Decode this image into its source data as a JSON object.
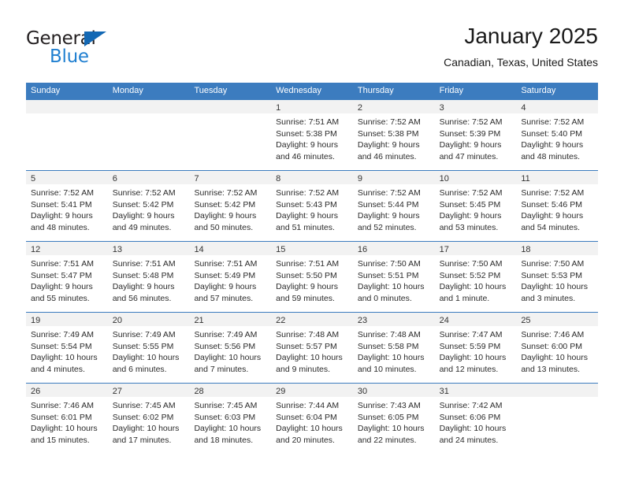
{
  "logo": {
    "word_top": "General",
    "word_bottom": "Blue",
    "triangle_icon": "triangle-icon",
    "color_blue": "#1f7fd0",
    "color_triangle": "#1368b4",
    "color_dark": "#231f20"
  },
  "header": {
    "title": "January 2025",
    "subtitle": "Canadian, Texas, United States"
  },
  "theme": {
    "header_bg": "#3c7cbf",
    "header_text": "#ffffff",
    "day_band_bg": "#f2f2f2",
    "row_border": "#3c7cbf"
  },
  "weekdays": [
    "Sunday",
    "Monday",
    "Tuesday",
    "Wednesday",
    "Thursday",
    "Friday",
    "Saturday"
  ],
  "weeks": [
    [
      {
        "day": "",
        "sunrise": "",
        "sunset": "",
        "daylight_line1": "",
        "daylight_line2": ""
      },
      {
        "day": "",
        "sunrise": "",
        "sunset": "",
        "daylight_line1": "",
        "daylight_line2": ""
      },
      {
        "day": "",
        "sunrise": "",
        "sunset": "",
        "daylight_line1": "",
        "daylight_line2": ""
      },
      {
        "day": "1",
        "sunrise": "Sunrise: 7:51 AM",
        "sunset": "Sunset: 5:38 PM",
        "daylight_line1": "Daylight: 9 hours",
        "daylight_line2": "and 46 minutes."
      },
      {
        "day": "2",
        "sunrise": "Sunrise: 7:52 AM",
        "sunset": "Sunset: 5:38 PM",
        "daylight_line1": "Daylight: 9 hours",
        "daylight_line2": "and 46 minutes."
      },
      {
        "day": "3",
        "sunrise": "Sunrise: 7:52 AM",
        "sunset": "Sunset: 5:39 PM",
        "daylight_line1": "Daylight: 9 hours",
        "daylight_line2": "and 47 minutes."
      },
      {
        "day": "4",
        "sunrise": "Sunrise: 7:52 AM",
        "sunset": "Sunset: 5:40 PM",
        "daylight_line1": "Daylight: 9 hours",
        "daylight_line2": "and 48 minutes."
      }
    ],
    [
      {
        "day": "5",
        "sunrise": "Sunrise: 7:52 AM",
        "sunset": "Sunset: 5:41 PM",
        "daylight_line1": "Daylight: 9 hours",
        "daylight_line2": "and 48 minutes."
      },
      {
        "day": "6",
        "sunrise": "Sunrise: 7:52 AM",
        "sunset": "Sunset: 5:42 PM",
        "daylight_line1": "Daylight: 9 hours",
        "daylight_line2": "and 49 minutes."
      },
      {
        "day": "7",
        "sunrise": "Sunrise: 7:52 AM",
        "sunset": "Sunset: 5:42 PM",
        "daylight_line1": "Daylight: 9 hours",
        "daylight_line2": "and 50 minutes."
      },
      {
        "day": "8",
        "sunrise": "Sunrise: 7:52 AM",
        "sunset": "Sunset: 5:43 PM",
        "daylight_line1": "Daylight: 9 hours",
        "daylight_line2": "and 51 minutes."
      },
      {
        "day": "9",
        "sunrise": "Sunrise: 7:52 AM",
        "sunset": "Sunset: 5:44 PM",
        "daylight_line1": "Daylight: 9 hours",
        "daylight_line2": "and 52 minutes."
      },
      {
        "day": "10",
        "sunrise": "Sunrise: 7:52 AM",
        "sunset": "Sunset: 5:45 PM",
        "daylight_line1": "Daylight: 9 hours",
        "daylight_line2": "and 53 minutes."
      },
      {
        "day": "11",
        "sunrise": "Sunrise: 7:52 AM",
        "sunset": "Sunset: 5:46 PM",
        "daylight_line1": "Daylight: 9 hours",
        "daylight_line2": "and 54 minutes."
      }
    ],
    [
      {
        "day": "12",
        "sunrise": "Sunrise: 7:51 AM",
        "sunset": "Sunset: 5:47 PM",
        "daylight_line1": "Daylight: 9 hours",
        "daylight_line2": "and 55 minutes."
      },
      {
        "day": "13",
        "sunrise": "Sunrise: 7:51 AM",
        "sunset": "Sunset: 5:48 PM",
        "daylight_line1": "Daylight: 9 hours",
        "daylight_line2": "and 56 minutes."
      },
      {
        "day": "14",
        "sunrise": "Sunrise: 7:51 AM",
        "sunset": "Sunset: 5:49 PM",
        "daylight_line1": "Daylight: 9 hours",
        "daylight_line2": "and 57 minutes."
      },
      {
        "day": "15",
        "sunrise": "Sunrise: 7:51 AM",
        "sunset": "Sunset: 5:50 PM",
        "daylight_line1": "Daylight: 9 hours",
        "daylight_line2": "and 59 minutes."
      },
      {
        "day": "16",
        "sunrise": "Sunrise: 7:50 AM",
        "sunset": "Sunset: 5:51 PM",
        "daylight_line1": "Daylight: 10 hours",
        "daylight_line2": "and 0 minutes."
      },
      {
        "day": "17",
        "sunrise": "Sunrise: 7:50 AM",
        "sunset": "Sunset: 5:52 PM",
        "daylight_line1": "Daylight: 10 hours",
        "daylight_line2": "and 1 minute."
      },
      {
        "day": "18",
        "sunrise": "Sunrise: 7:50 AM",
        "sunset": "Sunset: 5:53 PM",
        "daylight_line1": "Daylight: 10 hours",
        "daylight_line2": "and 3 minutes."
      }
    ],
    [
      {
        "day": "19",
        "sunrise": "Sunrise: 7:49 AM",
        "sunset": "Sunset: 5:54 PM",
        "daylight_line1": "Daylight: 10 hours",
        "daylight_line2": "and 4 minutes."
      },
      {
        "day": "20",
        "sunrise": "Sunrise: 7:49 AM",
        "sunset": "Sunset: 5:55 PM",
        "daylight_line1": "Daylight: 10 hours",
        "daylight_line2": "and 6 minutes."
      },
      {
        "day": "21",
        "sunrise": "Sunrise: 7:49 AM",
        "sunset": "Sunset: 5:56 PM",
        "daylight_line1": "Daylight: 10 hours",
        "daylight_line2": "and 7 minutes."
      },
      {
        "day": "22",
        "sunrise": "Sunrise: 7:48 AM",
        "sunset": "Sunset: 5:57 PM",
        "daylight_line1": "Daylight: 10 hours",
        "daylight_line2": "and 9 minutes."
      },
      {
        "day": "23",
        "sunrise": "Sunrise: 7:48 AM",
        "sunset": "Sunset: 5:58 PM",
        "daylight_line1": "Daylight: 10 hours",
        "daylight_line2": "and 10 minutes."
      },
      {
        "day": "24",
        "sunrise": "Sunrise: 7:47 AM",
        "sunset": "Sunset: 5:59 PM",
        "daylight_line1": "Daylight: 10 hours",
        "daylight_line2": "and 12 minutes."
      },
      {
        "day": "25",
        "sunrise": "Sunrise: 7:46 AM",
        "sunset": "Sunset: 6:00 PM",
        "daylight_line1": "Daylight: 10 hours",
        "daylight_line2": "and 13 minutes."
      }
    ],
    [
      {
        "day": "26",
        "sunrise": "Sunrise: 7:46 AM",
        "sunset": "Sunset: 6:01 PM",
        "daylight_line1": "Daylight: 10 hours",
        "daylight_line2": "and 15 minutes."
      },
      {
        "day": "27",
        "sunrise": "Sunrise: 7:45 AM",
        "sunset": "Sunset: 6:02 PM",
        "daylight_line1": "Daylight: 10 hours",
        "daylight_line2": "and 17 minutes."
      },
      {
        "day": "28",
        "sunrise": "Sunrise: 7:45 AM",
        "sunset": "Sunset: 6:03 PM",
        "daylight_line1": "Daylight: 10 hours",
        "daylight_line2": "and 18 minutes."
      },
      {
        "day": "29",
        "sunrise": "Sunrise: 7:44 AM",
        "sunset": "Sunset: 6:04 PM",
        "daylight_line1": "Daylight: 10 hours",
        "daylight_line2": "and 20 minutes."
      },
      {
        "day": "30",
        "sunrise": "Sunrise: 7:43 AM",
        "sunset": "Sunset: 6:05 PM",
        "daylight_line1": "Daylight: 10 hours",
        "daylight_line2": "and 22 minutes."
      },
      {
        "day": "31",
        "sunrise": "Sunrise: 7:42 AM",
        "sunset": "Sunset: 6:06 PM",
        "daylight_line1": "Daylight: 10 hours",
        "daylight_line2": "and 24 minutes."
      },
      {
        "day": "",
        "sunrise": "",
        "sunset": "",
        "daylight_line1": "",
        "daylight_line2": ""
      }
    ]
  ]
}
